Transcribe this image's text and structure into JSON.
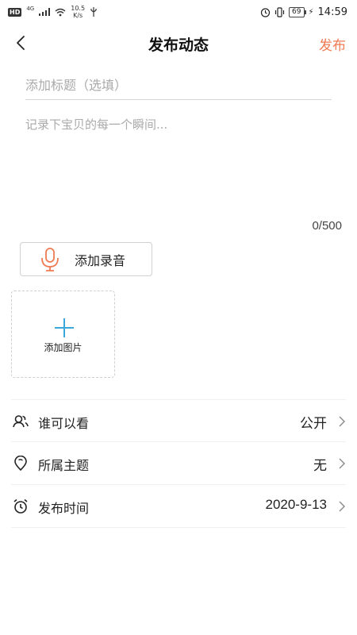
{
  "status_bar": {
    "network_badge": "HD",
    "network_type": "4G",
    "speed_value": "10.5",
    "speed_unit": "K/s",
    "battery": "69",
    "time": "14:59"
  },
  "header": {
    "title": "发布动态",
    "publish_label": "发布"
  },
  "form": {
    "title_placeholder": "添加标题（选填）",
    "content_placeholder": "记录下宝贝的每一个瞬间...",
    "char_count": "0/500",
    "add_audio_label": "添加录音",
    "add_image_label": "添加图片"
  },
  "settings": [
    {
      "label": "谁可以看",
      "value": "公开",
      "icon": "people-icon"
    },
    {
      "label": "所属主题",
      "value": "无",
      "icon": "location-pin-icon"
    },
    {
      "label": "发布时间",
      "value": "2020-9-13",
      "icon": "alarm-clock-icon"
    }
  ],
  "colors": {
    "accent": "#ef7b53",
    "plus": "#3aa8d8",
    "divider": "#f0f0f0"
  }
}
